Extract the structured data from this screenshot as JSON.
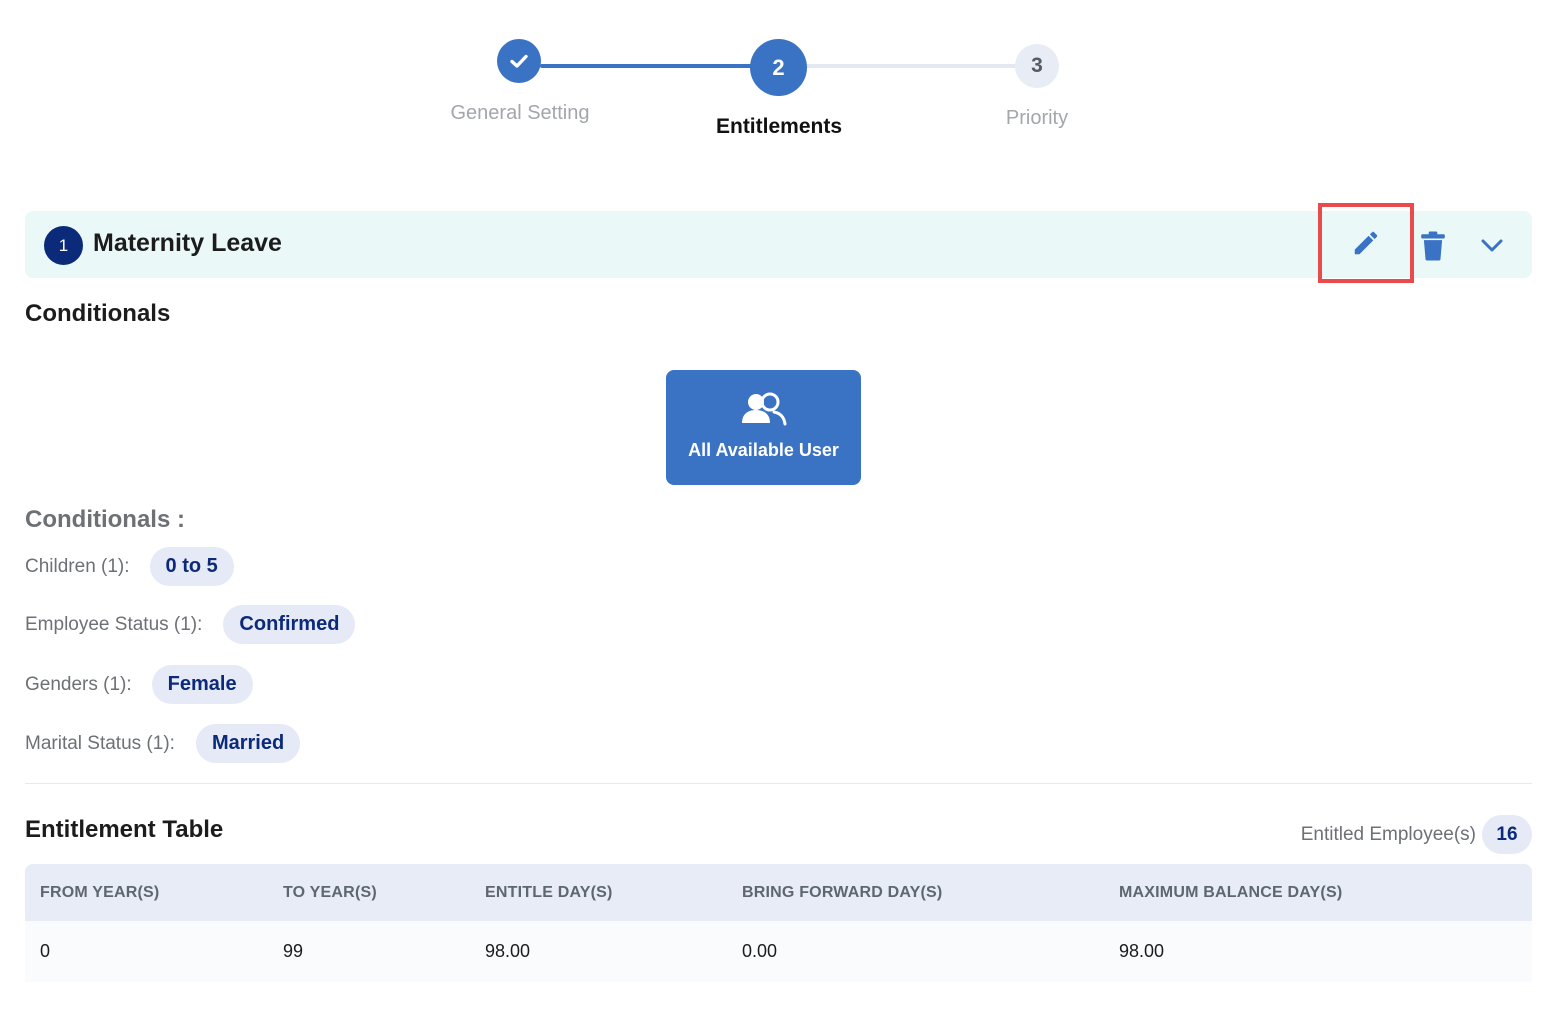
{
  "stepper": {
    "steps": [
      {
        "number": "",
        "label": "General Setting",
        "state": "completed"
      },
      {
        "number": "2",
        "label": "Entitlements",
        "state": "active"
      },
      {
        "number": "3",
        "label": "Priority",
        "state": "pending"
      }
    ]
  },
  "leave": {
    "index": "1",
    "title": "Maternity Leave",
    "actions": {
      "edit_icon": "pencil-icon",
      "delete_icon": "trash-icon",
      "expand_icon": "chevron-down-icon"
    }
  },
  "conditionals": {
    "title": "Conditionals",
    "card_label": "All Available User",
    "card_icon": "users-icon",
    "subtitle": "Conditionals :",
    "rows": [
      {
        "label": "Children (1):",
        "value": "0 to 5"
      },
      {
        "label": "Employee Status (1):",
        "value": "Confirmed"
      },
      {
        "label": "Genders (1):",
        "value": "Female"
      },
      {
        "label": "Marital Status (1):",
        "value": "Married"
      }
    ]
  },
  "entitlement_table": {
    "title": "Entitlement Table",
    "entitled_label": "Entitled Employee(s)",
    "entitled_count": "16",
    "columns": [
      "FROM YEAR(S)",
      "TO YEAR(S)",
      "ENTITLE DAY(S)",
      "BRING FORWARD DAY(S)",
      "MAXIMUM BALANCE DAY(S)"
    ],
    "rows": [
      [
        "0",
        "99",
        "98.00",
        "0.00",
        "98.00"
      ]
    ]
  },
  "colors": {
    "primary": "#3a72c4",
    "navy": "#0b2a7a",
    "header_bg": "#ebf8f8",
    "chip_bg": "#e6e9f6",
    "highlight": "#e94a4c"
  }
}
